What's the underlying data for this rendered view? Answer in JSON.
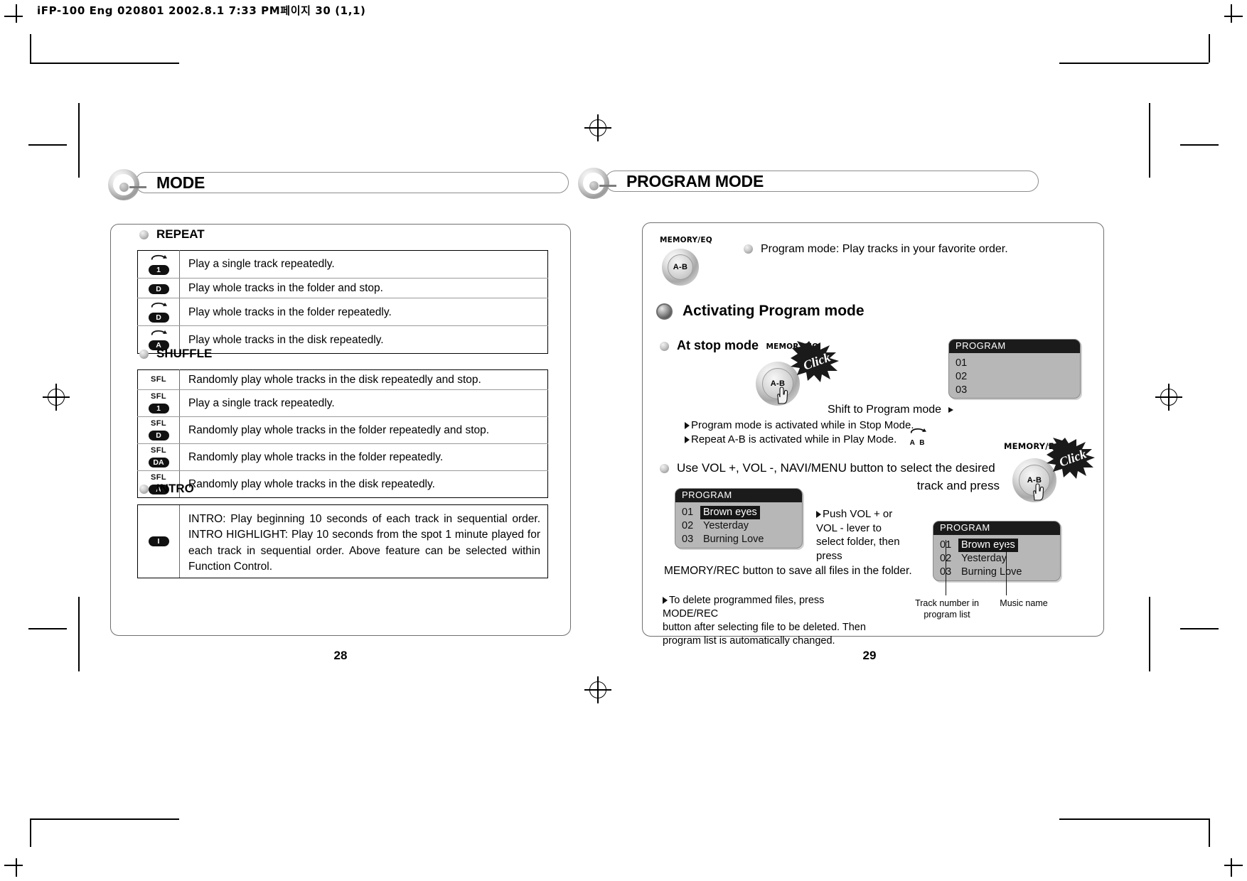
{
  "file_header": "iFP-100 Eng 020801  2002.8.1 7:33 PM페이지 30 (1,1)",
  "left_page": {
    "section_title": "MODE",
    "page_number": "28",
    "repeat": {
      "heading": "REPEAT",
      "rows": [
        {
          "icon": "repeat-1-icon",
          "loop": true,
          "badge": "1",
          "desc": "Play a single track repeatedly."
        },
        {
          "icon": "repeat-d-icon",
          "loop": false,
          "badge": "D",
          "desc": "Play whole tracks in the folder and stop."
        },
        {
          "icon": "repeat-loop-d-icon",
          "loop": true,
          "badge": "D",
          "desc": "Play whole tracks in the folder repeatedly."
        },
        {
          "icon": "repeat-loop-a-icon",
          "loop": true,
          "badge": "A",
          "desc": "Play whole tracks in the disk repeatedly."
        }
      ]
    },
    "shuffle": {
      "heading": "SHUFFLE",
      "rows": [
        {
          "icon": "shuffle-icon",
          "sfl": "SFL",
          "badge": "",
          "desc": "Randomly play whole tracks in the disk repeatedly and stop."
        },
        {
          "icon": "shuffle-1-icon",
          "sfl": "SFL",
          "badge": "1",
          "desc": "Play a single track repeatedly."
        },
        {
          "icon": "shuffle-d-icon",
          "sfl": "SFL",
          "badge": "D",
          "desc": "Randomly play whole tracks in the folder repeatedly and stop."
        },
        {
          "icon": "shuffle-da-icon",
          "sfl": "SFL",
          "badge": "DA",
          "desc": "Randomly play whole tracks in the folder repeatedly."
        },
        {
          "icon": "shuffle-a-icon",
          "sfl": "SFL",
          "badge": "A",
          "desc": "Randomly play whole tracks in the disk repeatedly."
        }
      ]
    },
    "intro": {
      "heading": "INTRO",
      "badge": "I",
      "text": "INTRO: Play beginning 10 seconds of each track in sequential order. INTRO HIGHLIGHT: Play 10 seconds from the spot 1 minute played for each track in sequential order. Above feature can be selected within Function Control.",
      "lines": [
        "INTRO: Play beginning 10 seconds of each track in sequential order.",
        "INTRO HIGHLIGHT: Play 10 seconds from the spot 1 minute played for each track in sequential order.",
        "Above feature can be selected within Function Control."
      ]
    }
  },
  "right_page": {
    "section_title": "PROGRAM MODE",
    "page_number": "29",
    "top_button_label": "MEMORY/EQ",
    "top_button_text": "A-B",
    "intro_line": "Program mode: Play tracks in your favorite order.",
    "activating_heading": "Activating Program mode",
    "at_stop_mode": "At stop mode",
    "at_stop_mode_button_label": "MEMORY/EQ",
    "at_stop_mode_button_text": "A-B",
    "click_label": "Click",
    "shift_label": "Shift to Program mode",
    "notes": [
      "Program mode is activated while in Stop Mode.",
      "Repeat A-B is activated while in Play Mode."
    ],
    "ab_icon_label": "A B",
    "display_empty": {
      "title": "PROGRAM",
      "rows": [
        {
          "num": "01",
          "name": ""
        },
        {
          "num": "02",
          "name": ""
        },
        {
          "num": "03",
          "name": ""
        }
      ]
    },
    "use_vol_line1": "Use VOL +, VOL -, NAVI/MENU button to select the desired",
    "use_vol_line2": "track and press",
    "display_left": {
      "title": "PROGRAM",
      "rows": [
        {
          "num": "01",
          "name": "Brown eyes",
          "selected": true
        },
        {
          "num": "02",
          "name": "Yesterday",
          "selected": false
        },
        {
          "num": "03",
          "name": "Burning Love",
          "selected": false
        }
      ]
    },
    "display_right": {
      "title": "PROGRAM",
      "rows": [
        {
          "num": "01",
          "name": "Brown eyes",
          "selected": true
        },
        {
          "num": "02",
          "name": "Yesterday",
          "selected": false
        },
        {
          "num": "03",
          "name": "Burning Love",
          "selected": false
        }
      ]
    },
    "push_vol_note": "Push VOL + or VOL - lever to select folder, then press",
    "memory_rec_note": "MEMORY/REC button to save all files in the folder.",
    "delete_note_line1": "To delete programmed files, press MODE/REC",
    "delete_note_line2": "button after selecting file to be deleted. Then",
    "delete_note_line3": "program list is automatically changed.",
    "second_button_label": "MEMORY/EQ",
    "second_button_text": "A-B",
    "second_click_label": "Click",
    "callout_track_number": "Track number in\nprogram list",
    "callout_track_number_l1": "Track number in",
    "callout_track_number_l2": "program list",
    "callout_music_name": "Music name"
  }
}
